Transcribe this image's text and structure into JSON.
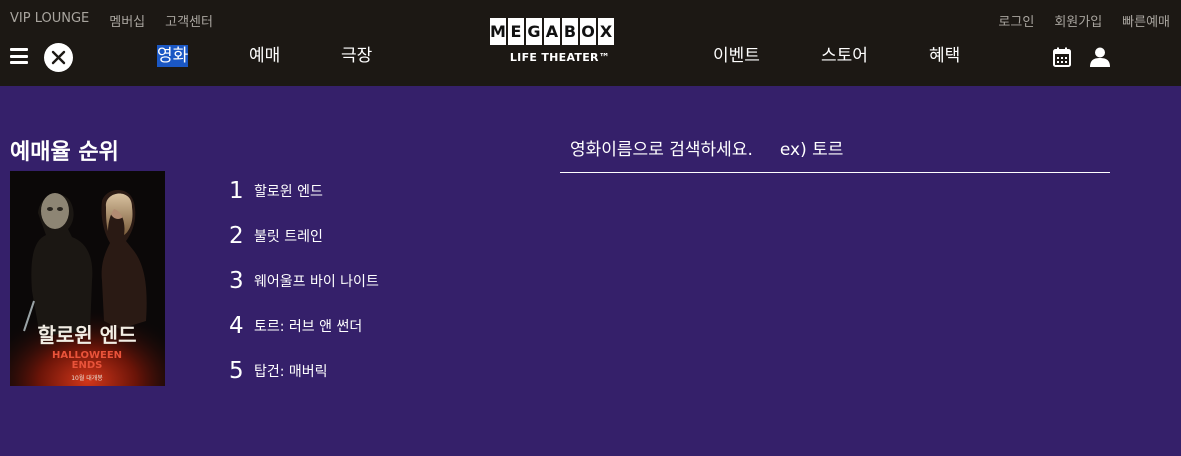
{
  "header": {
    "util_left": [
      "VIP LOUNGE",
      "멤버십",
      "고객센터"
    ],
    "util_right": [
      "로그인",
      "회원가입",
      "빠른예매"
    ],
    "nav_left": [
      "영화",
      "예매",
      "극장"
    ],
    "nav_right": [
      "이벤트",
      "스토어",
      "혜택"
    ],
    "logo_letters": [
      "M",
      "E",
      "G",
      "A",
      "B",
      "O",
      "X"
    ],
    "logo_sub": "LIFE THEATER™",
    "selected_nav": "영화"
  },
  "icons": {
    "menu": "hamburger-menu-icon",
    "close": "close-icon",
    "calendar": "calendar-icon",
    "user": "user-icon"
  },
  "main": {
    "section_title": "예매율 순위",
    "ranking": [
      {
        "rank": "1",
        "title": "할로윈 엔드"
      },
      {
        "rank": "2",
        "title": "불릿 트레인"
      },
      {
        "rank": "3",
        "title": "웨어울프 바이 나이트"
      },
      {
        "rank": "4",
        "title": "토르: 러브 앤 썬더"
      },
      {
        "rank": "5",
        "title": "탑건: 매버릭"
      }
    ],
    "poster": {
      "title_ko": "할로윈 엔드",
      "title_en_1": "HALLOWEEN",
      "title_en_2": "ENDS",
      "caption": "10월 대개봉"
    },
    "search": {
      "placeholder": "영화이름으로 검색하세요.     ex) 토르"
    }
  },
  "colors": {
    "header_bg": "#1c1814",
    "page_bg": "#35206a",
    "selected_highlight": "#1a57c4"
  }
}
